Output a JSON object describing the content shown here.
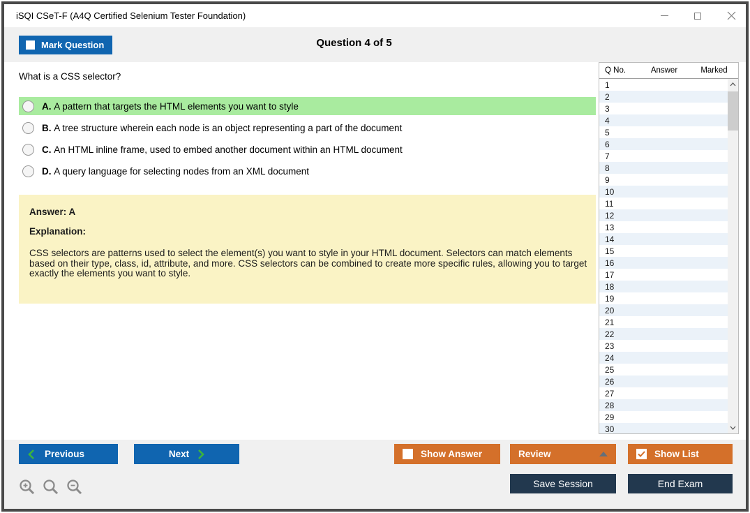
{
  "window": {
    "title": "iSQI CSeT-F (A4Q Certified Selenium Tester Foundation)"
  },
  "header": {
    "mark_question": "Mark Question",
    "question_counter": "Question 4 of 5"
  },
  "question": {
    "text": "What is a CSS selector?",
    "options": [
      {
        "letter": "A.",
        "text": "A pattern that targets the HTML elements you want to style",
        "highlighted": true
      },
      {
        "letter": "B.",
        "text": "A tree structure wherein each node is an object representing a part of the document",
        "highlighted": false
      },
      {
        "letter": "C.",
        "text": "An HTML inline frame, used to embed another document within an HTML document",
        "highlighted": false
      },
      {
        "letter": "D.",
        "text": "A query language for selecting nodes from an XML document",
        "highlighted": false
      }
    ]
  },
  "answer_panel": {
    "answer": "Answer: A",
    "explanation_heading": "Explanation:",
    "explanation_text": "CSS selectors are patterns used to select the element(s) you want to style in your HTML document. Selectors can match elements based on their type, class, id, attribute, and more. CSS selectors can be combined to create more specific rules, allowing you to target exactly the elements you want to style."
  },
  "question_list": {
    "headers": [
      "Q No.",
      "Answer",
      "Marked"
    ],
    "rows": [
      "1",
      "2",
      "3",
      "4",
      "5",
      "6",
      "7",
      "8",
      "9",
      "10",
      "11",
      "12",
      "13",
      "14",
      "15",
      "16",
      "17",
      "18",
      "19",
      "20",
      "21",
      "22",
      "23",
      "24",
      "25",
      "26",
      "27",
      "28",
      "29",
      "30"
    ]
  },
  "footer": {
    "previous": "Previous",
    "next": "Next",
    "show_answer": "Show Answer",
    "review": "Review",
    "show_list": "Show List",
    "save_session": "Save Session",
    "end_exam": "End Exam"
  },
  "icons": {
    "mark_question_checkbox": "unchecked",
    "show_answer_checkbox": "unchecked",
    "show_list_checkbox": "checked",
    "previous_chevron": "chevron-left",
    "next_chevron": "chevron-right",
    "review_dropdown": "triangle-up",
    "zoom_tools": [
      "zoom-in-icon",
      "zoom-icon",
      "zoom-out-icon"
    ]
  },
  "colors": {
    "accent_blue": "#1065b0",
    "accent_orange": "#d4702a",
    "dark_navy": "#22384e",
    "highlight_green": "#a9eb9f",
    "explanation_yellow": "#faf3c5",
    "chevron_green": "#3cb43c",
    "alt_row_blue": "#ebf2f9"
  }
}
